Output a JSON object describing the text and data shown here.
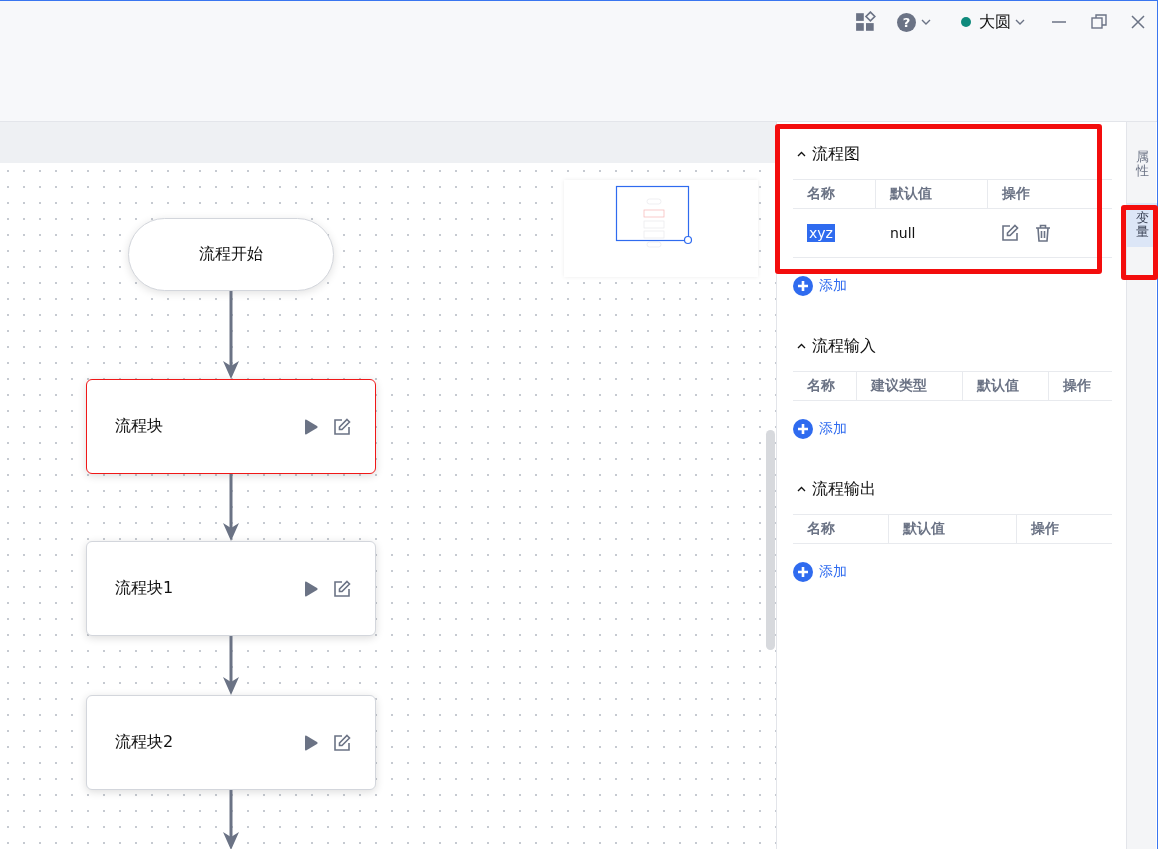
{
  "title_bar": {
    "help": "?",
    "user": {
      "name": "大圆"
    }
  },
  "canvas": {
    "nodes": [
      {
        "kind": "start",
        "label": "流程开始",
        "selected": false
      },
      {
        "kind": "block",
        "label": "流程块",
        "selected": true
      },
      {
        "kind": "block",
        "label": "流程块1",
        "selected": false
      },
      {
        "kind": "block",
        "label": "流程块2",
        "selected": false
      }
    ]
  },
  "panel": {
    "sections": [
      {
        "title": "流程图",
        "expanded": true,
        "columns": [
          "名称",
          "默认值",
          "操作"
        ],
        "rows": [
          {
            "name": "xyz",
            "default": "null",
            "highlighted": true
          }
        ],
        "add_label": "添加"
      },
      {
        "title": "流程输入",
        "expanded": true,
        "columns": [
          "名称",
          "建议类型",
          "默认值",
          "操作"
        ],
        "add_label": "添加"
      },
      {
        "title": "流程输出",
        "expanded": true,
        "columns": [
          "名称",
          "默认值",
          "操作"
        ],
        "add_label": "添加"
      }
    ]
  },
  "side_tabs": [
    {
      "label": "属性",
      "selected": false
    },
    {
      "label": "变量",
      "selected": true
    }
  ]
}
